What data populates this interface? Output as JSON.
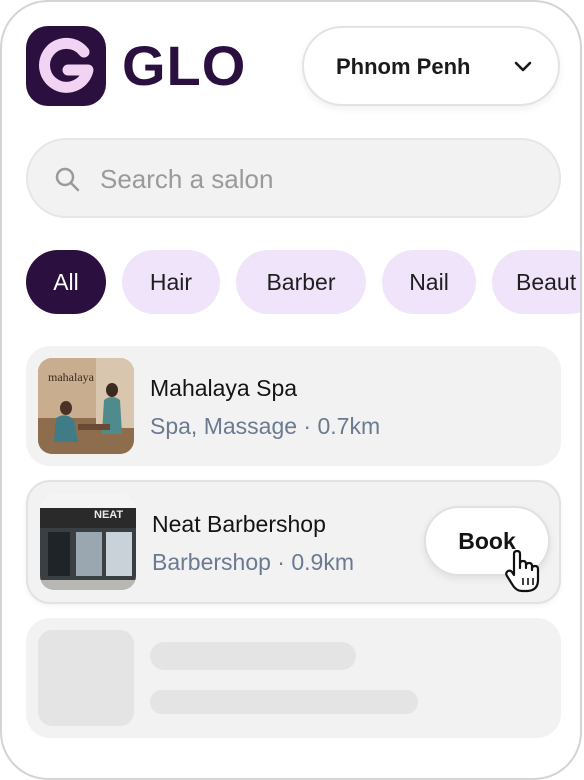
{
  "app": {
    "logo_text": "GLO",
    "logo_letter": "G"
  },
  "location": {
    "selected": "Phnom Penh"
  },
  "search": {
    "placeholder": "Search a salon",
    "value": ""
  },
  "categories": [
    "All",
    "Hair",
    "Barber",
    "Nail",
    "Beaut"
  ],
  "salons": [
    {
      "name": "Mahalaya Spa",
      "subtitle": "Spa, Massage · 0.7km",
      "thumb_text": "mahalaya"
    },
    {
      "name": "Neat Barbershop",
      "subtitle": "Barbershop · 0.9km",
      "thumb_text": "NEAT",
      "action": "Book"
    }
  ],
  "colors": {
    "brand": "#2a0f3f",
    "chip": "#f0e4fb",
    "subtitle": "#6b7a90"
  }
}
